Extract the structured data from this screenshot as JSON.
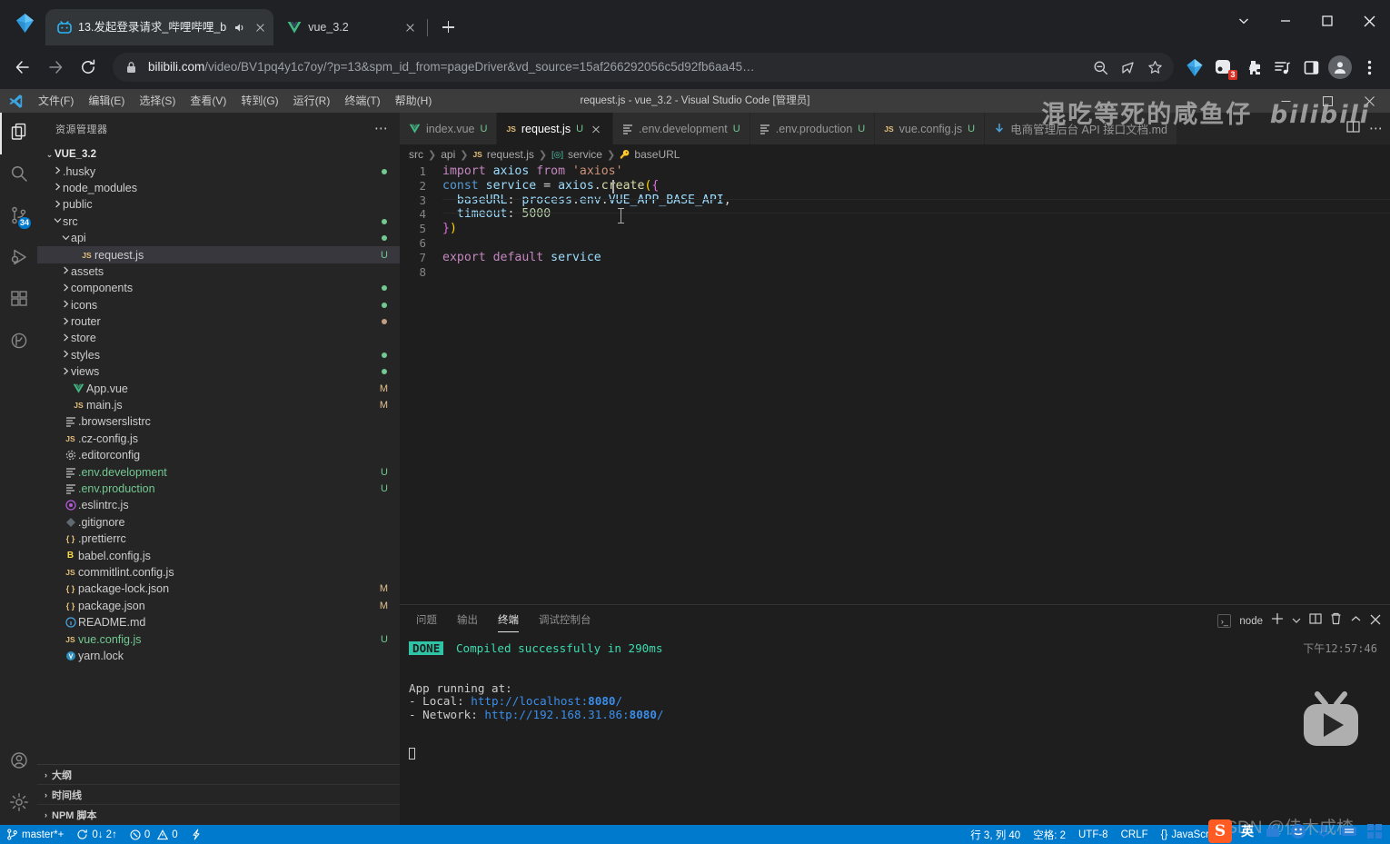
{
  "browser": {
    "tabs": [
      {
        "title": "13.发起登录请求_哔哩哔哩_b",
        "favicon": "bilibili-icon",
        "audio": true,
        "active": true
      },
      {
        "title": "vue_3.2",
        "favicon": "vue-icon",
        "audio": false,
        "active": false
      }
    ],
    "new_tab_label": "+",
    "url_host": "bilibili.com",
    "url_path": "/video/BV1pq4y1c7oy/?p=13&spm_id_from=pageDriver&vd_source=15af266292056c5d92fb6aa45…",
    "toolbar_icons": [
      "zoom-out-icon",
      "share-icon",
      "bookmark-star-icon",
      "gem-extension-icon",
      "screen-recorder-icon",
      "puzzle-extension-icon",
      "media-list-icon",
      "side-panel-icon",
      "profile-avatar-icon",
      "browser-menu-icon"
    ],
    "extension_badge": "3",
    "window_controls": [
      "chevron-down",
      "minimize",
      "maximize",
      "close"
    ]
  },
  "vscode": {
    "window_title": "request.js - vue_3.2 - Visual Studio Code [管理员]",
    "menu": [
      "文件(F)",
      "编辑(E)",
      "选择(S)",
      "查看(V)",
      "转到(G)",
      "运行(R)",
      "终端(T)",
      "帮助(H)"
    ],
    "activity_bar": [
      {
        "name": "explorer-icon",
        "active": true,
        "badge": ""
      },
      {
        "name": "search-icon",
        "active": false,
        "badge": ""
      },
      {
        "name": "source-control-icon",
        "active": false,
        "badge": "34"
      },
      {
        "name": "run-debug-icon",
        "active": false,
        "badge": ""
      },
      {
        "name": "extensions-icon",
        "active": false,
        "badge": ""
      },
      {
        "name": "testing-icon",
        "active": false,
        "badge": ""
      },
      {
        "name": "accounts-icon",
        "active": false,
        "badge": ""
      },
      {
        "name": "settings-gear-icon",
        "active": false,
        "badge": ""
      }
    ],
    "sidebar": {
      "title": "资源管理器",
      "more_actions": "⋯",
      "root": "VUE_3.2",
      "items": [
        {
          "label": ".husky",
          "type": "folder",
          "indent": 1,
          "expanded": false,
          "status": "",
          "dot": "#73c991"
        },
        {
          "label": "node_modules",
          "type": "folder",
          "indent": 1,
          "expanded": false,
          "status": "",
          "dot": ""
        },
        {
          "label": "public",
          "type": "folder",
          "indent": 1,
          "expanded": false,
          "status": "",
          "dot": ""
        },
        {
          "label": "src",
          "type": "folder",
          "indent": 1,
          "expanded": true,
          "status": "",
          "dot": "#73c991"
        },
        {
          "label": "api",
          "type": "folder",
          "indent": 2,
          "expanded": true,
          "status": "",
          "dot": "#73c991"
        },
        {
          "label": "request.js",
          "type": "js",
          "indent": 3,
          "selected": true,
          "status": "U",
          "dot": ""
        },
        {
          "label": "assets",
          "type": "folder",
          "indent": 2,
          "expanded": false,
          "status": "",
          "dot": ""
        },
        {
          "label": "components",
          "type": "folder",
          "indent": 2,
          "expanded": false,
          "status": "",
          "dot": "#73c991"
        },
        {
          "label": "icons",
          "type": "folder",
          "indent": 2,
          "expanded": false,
          "status": "",
          "dot": "#73c991"
        },
        {
          "label": "router",
          "type": "folder",
          "indent": 2,
          "expanded": false,
          "status": "",
          "dot": "#c0a080"
        },
        {
          "label": "store",
          "type": "folder",
          "indent": 2,
          "expanded": false,
          "status": "",
          "dot": ""
        },
        {
          "label": "styles",
          "type": "folder",
          "indent": 2,
          "expanded": false,
          "status": "",
          "dot": "#73c991"
        },
        {
          "label": "views",
          "type": "folder",
          "indent": 2,
          "expanded": false,
          "status": "",
          "dot": "#73c991"
        },
        {
          "label": "App.vue",
          "type": "vue",
          "indent": 2,
          "status": "M",
          "dot": ""
        },
        {
          "label": "main.js",
          "type": "js",
          "indent": 2,
          "status": "M",
          "dot": ""
        },
        {
          "label": ".browserslistrc",
          "type": "config",
          "indent": 1,
          "status": "",
          "dot": ""
        },
        {
          "label": ".cz-config.js",
          "type": "js",
          "indent": 1,
          "status": "",
          "dot": ""
        },
        {
          "label": ".editorconfig",
          "type": "gear",
          "indent": 1,
          "status": "",
          "dot": ""
        },
        {
          "label": ".env.development",
          "type": "config",
          "indent": 1,
          "status": "U",
          "dot": "",
          "color": "#73c991"
        },
        {
          "label": ".env.production",
          "type": "config",
          "indent": 1,
          "status": "U",
          "dot": "",
          "color": "#73c991"
        },
        {
          "label": ".eslintrc.js",
          "type": "eslint",
          "indent": 1,
          "status": "",
          "dot": ""
        },
        {
          "label": ".gitignore",
          "type": "git",
          "indent": 1,
          "status": "",
          "dot": ""
        },
        {
          "label": ".prettierrc",
          "type": "json",
          "indent": 1,
          "status": "",
          "dot": ""
        },
        {
          "label": "babel.config.js",
          "type": "babel",
          "indent": 1,
          "status": "",
          "dot": ""
        },
        {
          "label": "commitlint.config.js",
          "type": "js",
          "indent": 1,
          "status": "",
          "dot": ""
        },
        {
          "label": "package-lock.json",
          "type": "json",
          "indent": 1,
          "status": "M",
          "dot": ""
        },
        {
          "label": "package.json",
          "type": "json",
          "indent": 1,
          "status": "M",
          "dot": ""
        },
        {
          "label": "README.md",
          "type": "md",
          "indent": 1,
          "status": "",
          "dot": ""
        },
        {
          "label": "vue.config.js",
          "type": "js",
          "indent": 1,
          "status": "U",
          "dot": "",
          "color": "#73c991"
        },
        {
          "label": "yarn.lock",
          "type": "yarn",
          "indent": 1,
          "status": "",
          "dot": ""
        }
      ],
      "sections": [
        "大纲",
        "时间线",
        "NPM 脚本"
      ]
    },
    "editor_tabs": [
      {
        "label": "index.vue",
        "icon": "vue-icon",
        "status": "U",
        "active": false
      },
      {
        "label": "request.js",
        "icon": "js-icon",
        "status": "U",
        "active": true
      },
      {
        "label": ".env.development",
        "icon": "config-icon",
        "status": "U",
        "active": false
      },
      {
        "label": ".env.production",
        "icon": "config-icon",
        "status": "U",
        "active": false
      },
      {
        "label": "vue.config.js",
        "icon": "js-icon",
        "status": "U",
        "active": false
      },
      {
        "label": "电商管理后台 API 接口文档.md",
        "icon": "md-icon",
        "status": "",
        "active": false
      }
    ],
    "breadcrumb": [
      "src",
      "api",
      "request.js",
      "service",
      "baseURL"
    ],
    "code_lines": [
      {
        "n": "1",
        "text": "import axios from 'axios'"
      },
      {
        "n": "2",
        "text": "const service = axios.create({"
      },
      {
        "n": "3",
        "text": "  baseURL: process.env.VUE_APP_BASE_API,"
      },
      {
        "n": "4",
        "text": "  timeout: 5000"
      },
      {
        "n": "5",
        "text": "})"
      },
      {
        "n": "6",
        "text": ""
      },
      {
        "n": "7",
        "text": "export default service"
      },
      {
        "n": "8",
        "text": ""
      }
    ],
    "editor_watermark": "混吃等死的咸鱼仔",
    "editor_watermark_logo": "bilibili",
    "panel": {
      "tabs": [
        "问题",
        "输出",
        "终端",
        "调试控制台"
      ],
      "active_tab": "终端",
      "shell_label": "node",
      "time": "下午12:57:46",
      "lines": [
        {
          "badge": "DONE",
          "text": "Compiled successfully in 290ms"
        },
        {
          "text": ""
        },
        {
          "text": ""
        },
        {
          "text": "  App running at:"
        },
        {
          "text": "  - Local:   http://localhost:8080/",
          "link": true
        },
        {
          "text": "  - Network: http://192.168.31.86:8080/",
          "link": true
        }
      ],
      "local_url": "http://localhost:8080/",
      "network_url": "http://192.168.31.86:8080/",
      "controls": [
        "new-terminal-icon",
        "split-terminal-icon",
        "kill-terminal-icon",
        "maximize-panel-icon",
        "close-panel-icon"
      ]
    },
    "statusbar": {
      "branch": "master*+",
      "sync": "0↓ 2↑",
      "errors": "0",
      "warnings": "0",
      "line_col": "行 3, 列 40",
      "spaces": "空格: 2",
      "encoding": "UTF-8",
      "eol": "CRLF",
      "language": "JavaScript",
      "ime": "英"
    }
  },
  "overlay": {
    "csdn_watermark": "CSDN @佳木成楂",
    "sogou_label": "S"
  },
  "colors": {
    "accent": "#007acc",
    "statusbar": "#007acc",
    "editor_bg": "#1e1e1e",
    "sidebar_bg": "#252526",
    "green_modified": "#73c991",
    "badge_red": "#d93025"
  }
}
